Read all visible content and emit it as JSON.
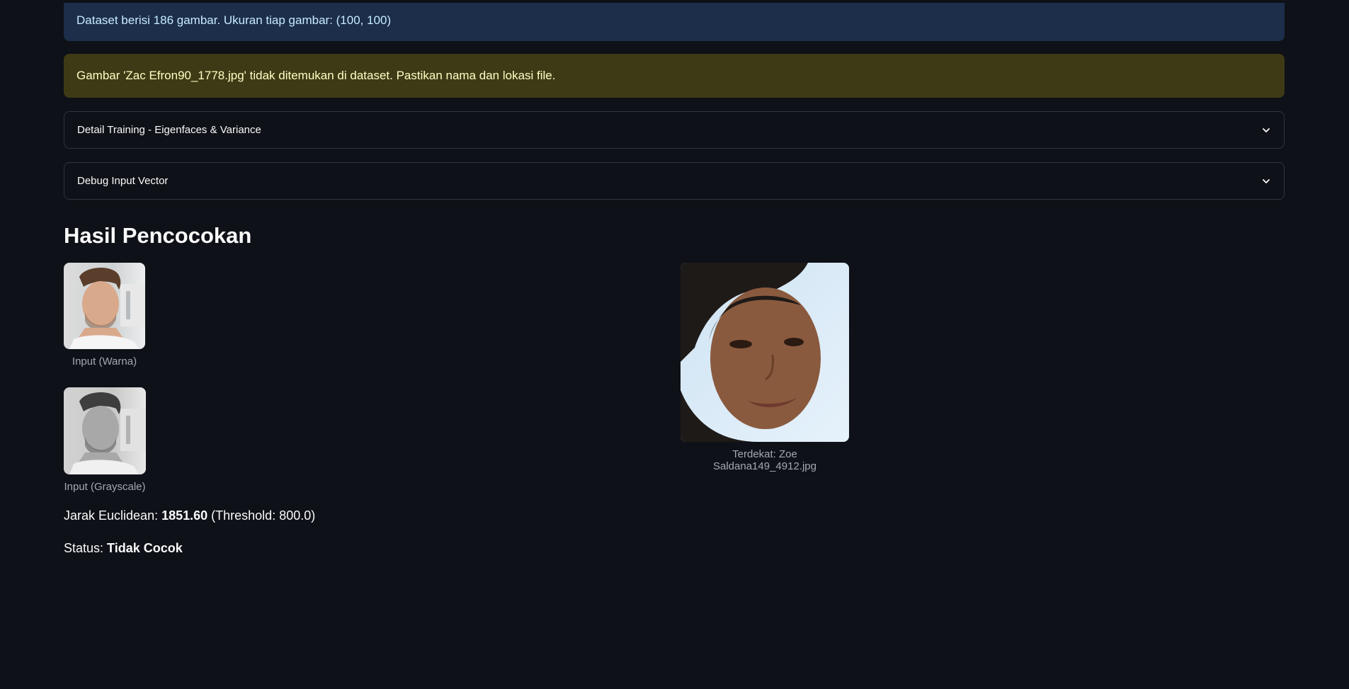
{
  "info_alert": {
    "text": "Dataset berisi 186 gambar. Ukuran tiap gambar: (100, 100)"
  },
  "warning_alert": {
    "text": "Gambar 'Zac Efron90_1778.jpg' tidak ditemukan di dataset. Pastikan nama dan lokasi file."
  },
  "expanders": [
    {
      "label": "Detail Training - Eigenfaces & Variance"
    },
    {
      "label": "Debug Input Vector"
    }
  ],
  "results": {
    "title": "Hasil Pencocokan",
    "input_color_caption": "Input (Warna)",
    "input_gray_caption": "Input (Grayscale)",
    "nearest_caption": "Terdekat: Zoe Saldana149_4912.jpg",
    "distance_prefix": "Jarak Euclidean: ",
    "distance_value": "1851.60",
    "distance_suffix": " (Threshold: 800.0)",
    "status_prefix": "Status: ",
    "status_value": "Tidak Cocok"
  },
  "colors": {
    "background": "#0e1117",
    "info_bg": "#1c2e4a",
    "info_text": "#c7ebff",
    "warning_bg": "#3e3a16",
    "warning_text": "#ffffc2",
    "border": "#31333f"
  },
  "icons": {
    "expander": "chevron-down-icon"
  }
}
